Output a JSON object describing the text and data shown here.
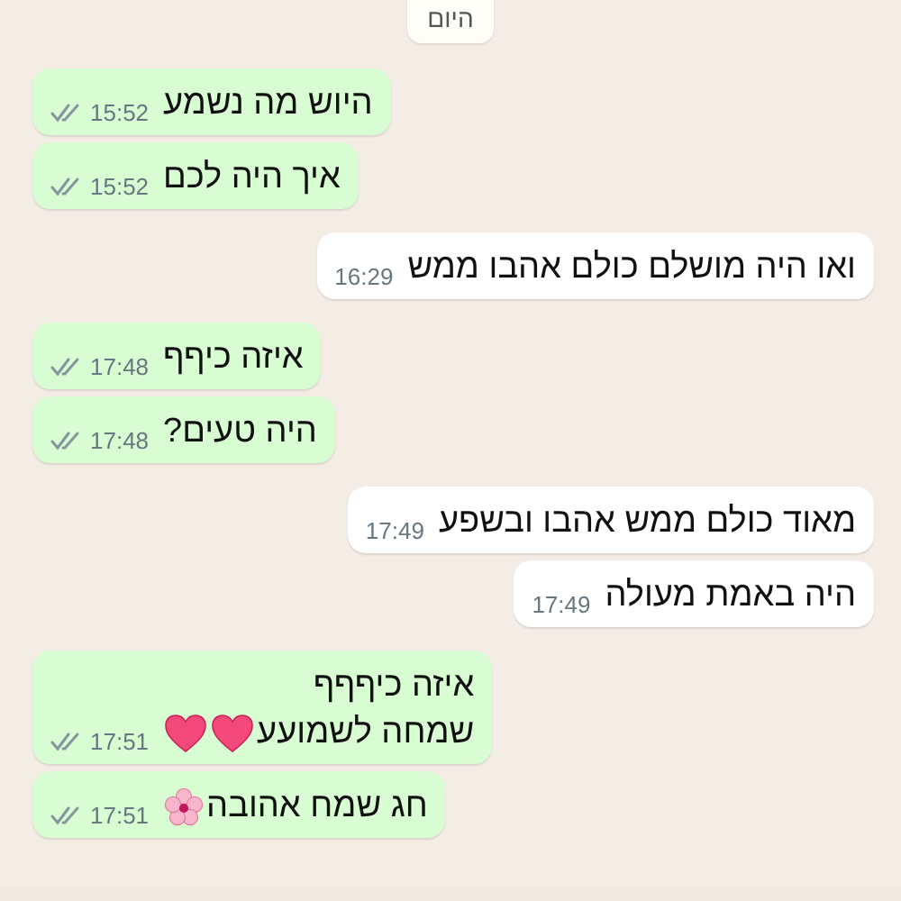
{
  "date_chip": "היום",
  "messages": [
    {
      "kind": "sent",
      "lines": [
        {
          "text": "היוש מה נשמע"
        }
      ],
      "time": "15:52",
      "read": false
    },
    {
      "kind": "sent",
      "lines": [
        {
          "text": "איך היה לכם"
        }
      ],
      "time": "15:52",
      "read": false
    },
    {
      "kind": "received",
      "lines": [
        {
          "text": "ואו היה מושלם כולם אהבו ממש"
        }
      ],
      "time": "16:29"
    },
    {
      "kind": "sent",
      "lines": [
        {
          "text": "איזה כיףף"
        }
      ],
      "time": "17:48",
      "read": false
    },
    {
      "kind": "sent",
      "lines": [
        {
          "text": "היה טעים?"
        }
      ],
      "time": "17:48",
      "read": false
    },
    {
      "kind": "received",
      "lines": [
        {
          "text": "מאוד כולם ממש אהבו ובשפע"
        }
      ],
      "time": "17:49"
    },
    {
      "kind": "received",
      "lines": [
        {
          "text": "היה באמת מעולה"
        }
      ],
      "time": "17:49"
    },
    {
      "kind": "sent",
      "lines": [
        {
          "text": "איזה כיףףף"
        },
        {
          "text": "שמחה לשמועע",
          "icons": [
            {
              "kind": "heart"
            },
            {
              "kind": "heart"
            }
          ]
        }
      ],
      "time": "17:51",
      "read": false
    },
    {
      "kind": "sent",
      "lines": [
        {
          "text": "חג שמח אהובה",
          "icons": [
            {
              "kind": "blossom"
            }
          ]
        }
      ],
      "time": "17:51",
      "read": false
    }
  ]
}
